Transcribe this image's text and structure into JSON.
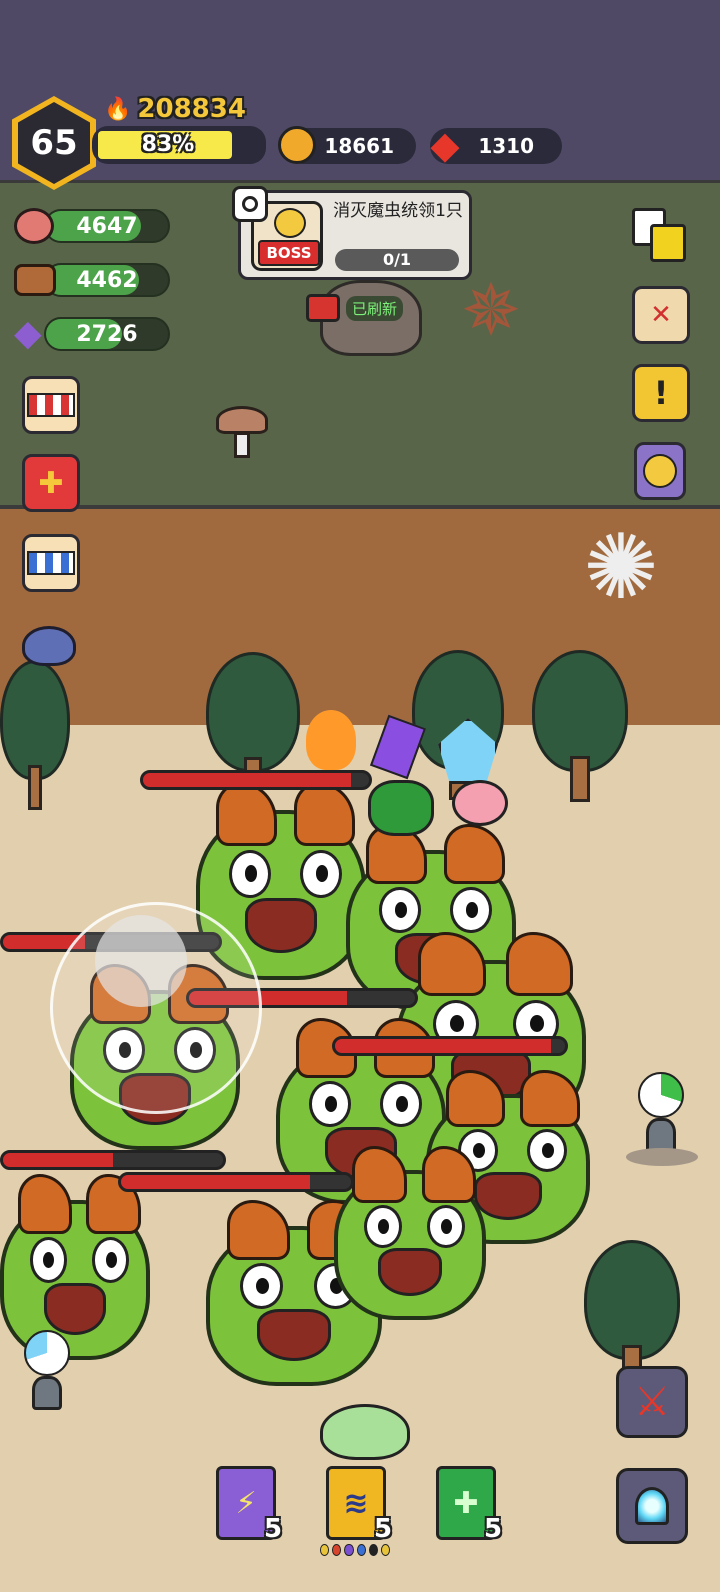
{
  "player": {
    "level": "65",
    "power": "208834",
    "xp_percent_label": "83%",
    "xp_fraction": 0.83
  },
  "currency": {
    "gold": "18661",
    "gems": "1310"
  },
  "resources": {
    "meat": "4647",
    "wood": "4462",
    "crystal": "2726"
  },
  "quest": {
    "boss_badge": "BOSS",
    "title": "消灭魔虫统领1只",
    "progress": "0/1",
    "refresh_label": "已刷新"
  },
  "skill_books": [
    {
      "name": "lightning-book",
      "count": "5",
      "color": "#8a5ed4",
      "glyph": "⚡"
    },
    {
      "name": "wind-book",
      "count": "5",
      "color": "#f0b722",
      "glyph": "≋"
    },
    {
      "name": "heal-book",
      "count": "5",
      "color": "#2fa84a",
      "glyph": "✚"
    }
  ],
  "colors": {
    "gold_accent": "#f2b51f",
    "hp_red": "#d12d2d",
    "xp_yellow": "#f7e94a"
  }
}
